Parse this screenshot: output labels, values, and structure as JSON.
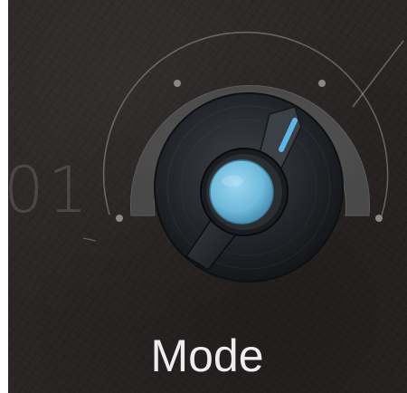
{
  "control": {
    "label": "Mode",
    "value_readout": "01"
  },
  "colors": {
    "background": "#2b2626",
    "accent": "#7ec6e6",
    "indicator": "#5fb6e4",
    "label_text": "#ededed"
  },
  "icons": {
    "dial": "mode-knob",
    "stops": "scale-dot"
  }
}
